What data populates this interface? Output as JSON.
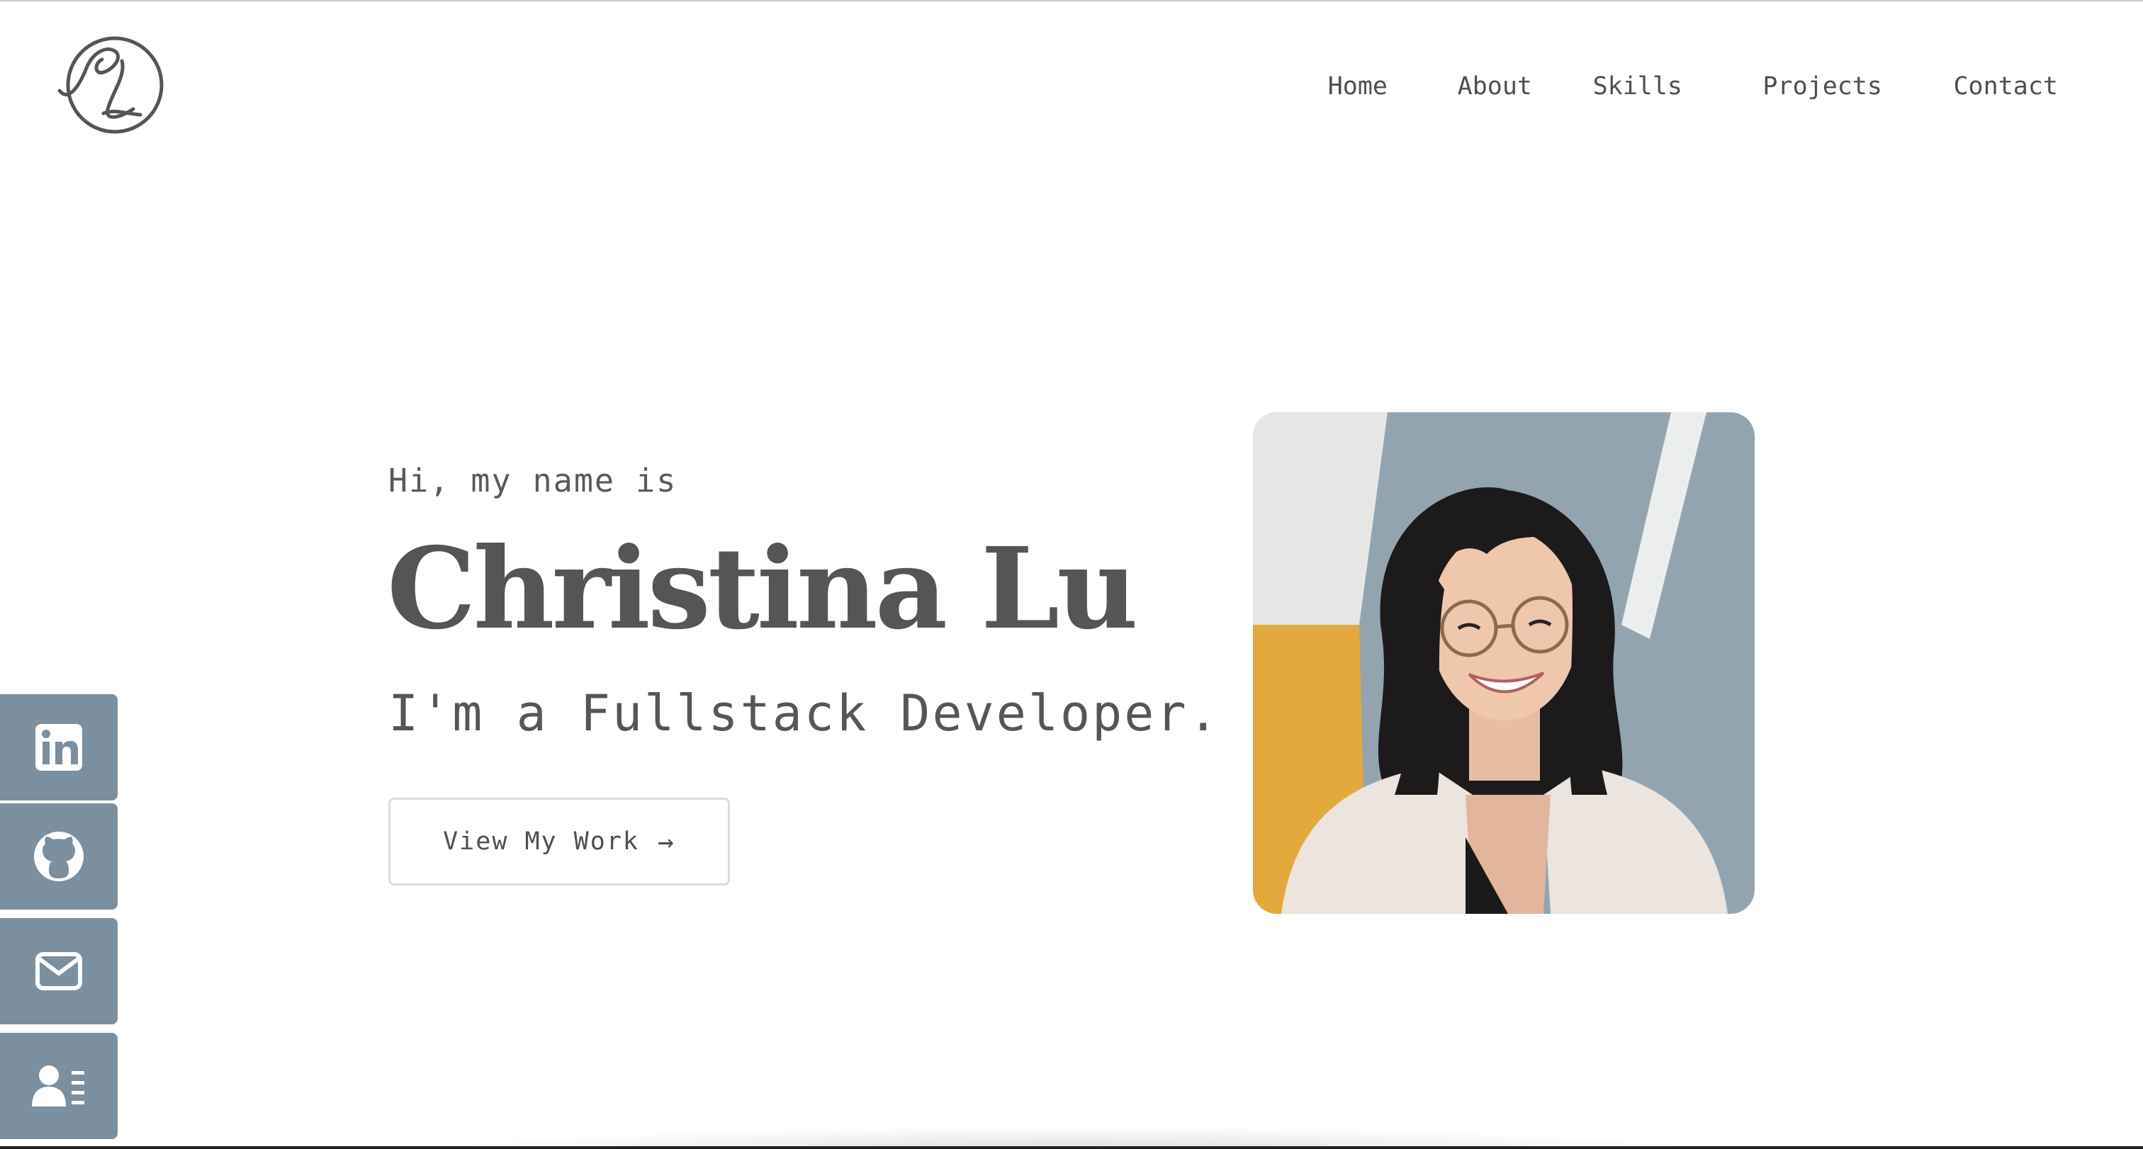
{
  "header": {
    "logo_text": "CL",
    "nav": [
      {
        "label": "Home"
      },
      {
        "label": "About"
      },
      {
        "label": "Skills"
      },
      {
        "label": "Projects"
      },
      {
        "label": "Contact"
      }
    ]
  },
  "hero": {
    "greeting": "Hi, my name is",
    "name": "Christina Lu",
    "tagline": "I'm a Fullstack Developer.",
    "cta_label": "View My Work",
    "cta_icon": "arrow-right-icon",
    "photo_alt": "Portrait photo of Christina Lu"
  },
  "social": [
    {
      "icon": "linkedin-icon"
    },
    {
      "icon": "github-icon"
    },
    {
      "icon": "mail-icon"
    },
    {
      "icon": "resume-icon"
    }
  ],
  "colors": {
    "text": "#555555",
    "sidebar": "#7b8f9e",
    "button_border": "#dcdcdc"
  }
}
